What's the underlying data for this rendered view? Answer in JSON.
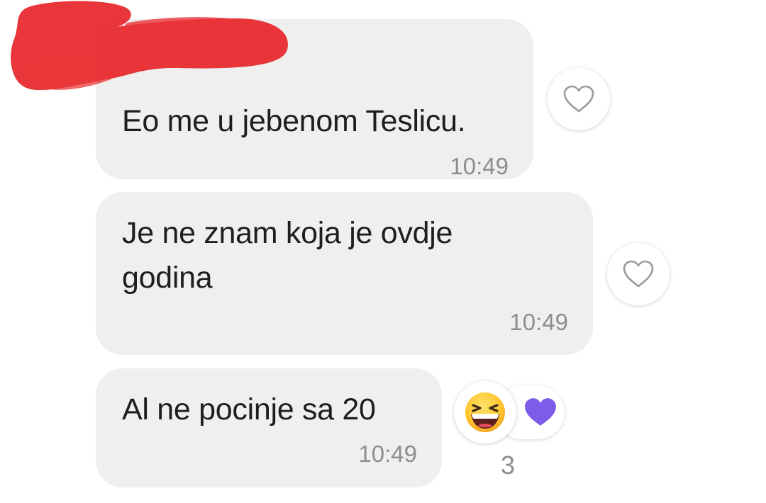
{
  "messages": [
    {
      "text_lines": [
        "Eo me u jebenom Teslicu."
      ],
      "time": "10:49"
    },
    {
      "text_lines": [
        "Je ne znam koja je ovdje",
        "godina"
      ],
      "time": "10:49"
    },
    {
      "text_lines": [
        "Al ne pocinje sa 20"
      ],
      "time": "10:49"
    }
  ],
  "reactions": {
    "emojis": [
      "grinning-squinting-face",
      "purple-heart"
    ],
    "count": "3"
  },
  "icons": {
    "like": "heart-outline-icon"
  },
  "colors": {
    "bubble": "#efefef",
    "text": "#1e1e1e",
    "timestamp": "#8d8d8d",
    "purple_heart": "#7c5ce8",
    "redaction": "#e8262a"
  }
}
